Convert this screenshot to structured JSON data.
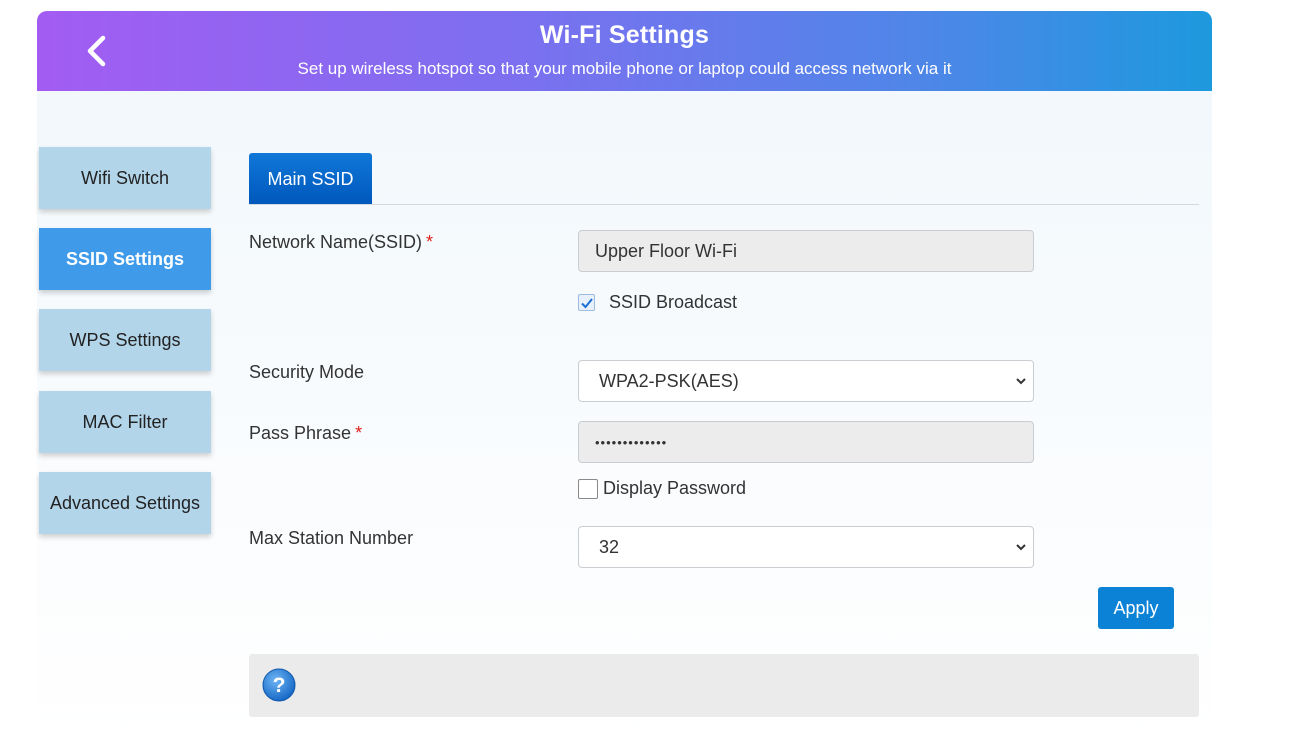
{
  "header": {
    "title": "Wi-Fi Settings",
    "subtitle": "Set up wireless hotspot so that your mobile phone or laptop could access network via it",
    "back_icon": "chevron-left-icon"
  },
  "sidebar": {
    "items": [
      {
        "label": "Wifi Switch",
        "active": false
      },
      {
        "label": "SSID Settings",
        "active": true
      },
      {
        "label": "WPS Settings",
        "active": false
      },
      {
        "label": "MAC Filter",
        "active": false
      },
      {
        "label": "Advanced Settings",
        "active": false
      }
    ]
  },
  "tabs": [
    {
      "label": "Main SSID",
      "active": true
    }
  ],
  "form": {
    "ssid": {
      "label": "Network Name(SSID)",
      "required_mark": "*",
      "value": "Upper Floor Wi-Fi"
    },
    "ssid_broadcast": {
      "label": "SSID Broadcast",
      "checked": true
    },
    "security_mode": {
      "label": "Security Mode",
      "value": "WPA2-PSK(AES)"
    },
    "pass_phrase": {
      "label": "Pass Phrase",
      "required_mark": "*",
      "value": "•••••••••••••"
    },
    "display_password": {
      "label": "Display Password",
      "checked": false
    },
    "max_station": {
      "label": "Max Station Number",
      "value": "32"
    },
    "apply_label": "Apply"
  },
  "help": {
    "icon": "question-icon"
  },
  "colors": {
    "header_gradient_start": "#a35cf2",
    "header_gradient_end": "#1d99de",
    "sidebar_item": "#b3d5ea",
    "sidebar_active": "#3f9bea",
    "tab_active": "#0a6ccc",
    "apply_button": "#0b82d6",
    "required": "#e0201c"
  }
}
